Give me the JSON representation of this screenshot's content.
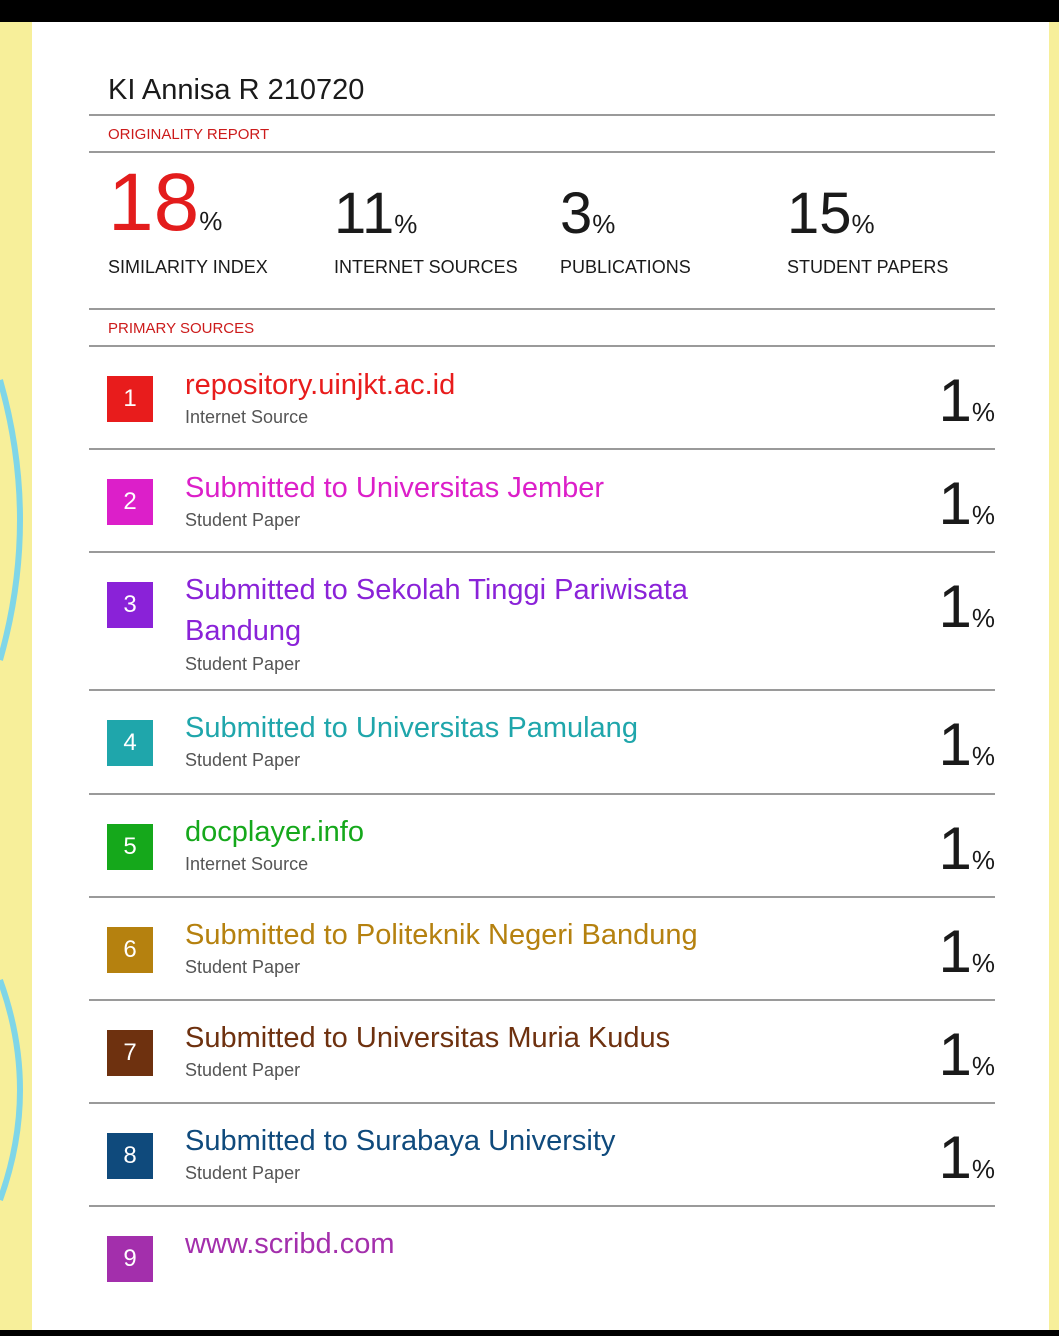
{
  "report": {
    "title": "KI Annisa R 210720",
    "originality_label": "ORIGINALITY REPORT",
    "primary_sources_label": "PRIMARY SOURCES"
  },
  "stats": [
    {
      "value": "18",
      "unit": "%",
      "label": "SIMILARITY INDEX"
    },
    {
      "value": "11",
      "unit": "%",
      "label": "INTERNET SOURCES"
    },
    {
      "value": "3",
      "unit": "%",
      "label": "PUBLICATIONS"
    },
    {
      "value": "15",
      "unit": "%",
      "label": "STUDENT PAPERS"
    }
  ],
  "sources": [
    {
      "rank": "1",
      "name": "repository.uinjkt.ac.id",
      "type": "Internet Source",
      "percent": "1",
      "unit": "%",
      "color": "#e81c1c"
    },
    {
      "rank": "2",
      "name": "Submitted to Universitas Jember",
      "type": "Student Paper",
      "percent": "1",
      "unit": "%",
      "color": "#dc1fc9"
    },
    {
      "rank": "3",
      "name": "Submitted to Sekolah Tinggi Pariwisata Bandung",
      "type": "Student Paper",
      "percent": "1",
      "unit": "%",
      "color": "#8a22d8"
    },
    {
      "rank": "4",
      "name": "Submitted to Universitas Pamulang",
      "type": "Student Paper",
      "percent": "1",
      "unit": "%",
      "color": "#1fa6ab"
    },
    {
      "rank": "5",
      "name": "docplayer.info",
      "type": "Internet Source",
      "percent": "1",
      "unit": "%",
      "color": "#15a81b"
    },
    {
      "rank": "6",
      "name": "Submitted to Politeknik Negeri Bandung",
      "type": "Student Paper",
      "percent": "1",
      "unit": "%",
      "color": "#b5810f"
    },
    {
      "rank": "7",
      "name": "Submitted to Universitas Muria Kudus",
      "type": "Student Paper",
      "percent": "1",
      "unit": "%",
      "color": "#6e310f"
    },
    {
      "rank": "8",
      "name": "Submitted to Surabaya University",
      "type": "Student Paper",
      "percent": "1",
      "unit": "%",
      "color": "#0f4a7c"
    },
    {
      "rank": "9",
      "name": "www.scribd.com",
      "type": "",
      "percent": "",
      "unit": "",
      "color": "#a32fac"
    }
  ]
}
